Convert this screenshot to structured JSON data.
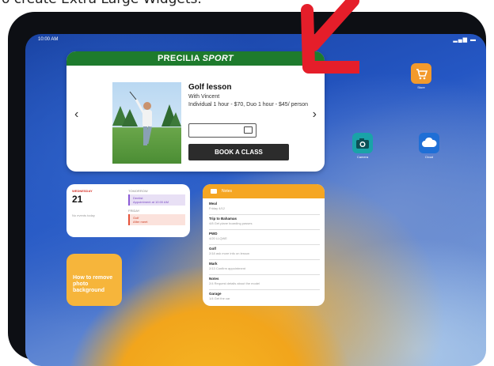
{
  "caption": "o create Extra Large Widgets.",
  "status_bar": {
    "time": "10:00 AM",
    "icons": "wifi battery"
  },
  "class_widget": {
    "brand": "PRECILIA",
    "brand_suffix": "SPORT",
    "title": "Golf lesson",
    "with": "With Vincent",
    "price": "Individual 1 hour - $70, Duo 1 hour - $45/ person",
    "book_label": "BOOK A CLASS",
    "colors": {
      "header": "#1e7b2d",
      "button": "#2c2c2c"
    }
  },
  "apps": [
    {
      "name": "Store",
      "icon": "cart-icon",
      "color": "#f39a2c"
    },
    {
      "name": "Camera",
      "icon": "camera-icon",
      "color": "#1aa3a8"
    },
    {
      "name": "Cloud",
      "icon": "cloud-icon",
      "color": "#1f6fd6"
    }
  ],
  "calendar_widget": {
    "day": "WEDNESDAY",
    "date": "21",
    "no_events": "No events today",
    "tomorrow_label": "TOMORROW",
    "tomorrow_event": {
      "title": "Dentist",
      "detail": "Appointment at 10:00 AM"
    },
    "friday_label": "FRIDAY",
    "friday_event": {
      "title": "Golf",
      "detail": "After meet"
    }
  },
  "notes_widget": {
    "header": "Notes",
    "notes": [
      {
        "title": "Meal",
        "subtitle": "Friday 4/12"
      },
      {
        "title": "Trip to Bahamas",
        "subtitle": "4/8 Get plane boarding passes"
      },
      {
        "title": "PWD",
        "subtitle": "4/20 LLQWE"
      },
      {
        "title": "Golf",
        "subtitle": "2/18 ask more info on lesson"
      },
      {
        "title": "Mark",
        "subtitle": "2/13 Confirm appointment"
      },
      {
        "title": "Notes",
        "subtitle": "2/4 Request details about the model"
      },
      {
        "title": "Garage",
        "subtitle": "1/4 Get the car"
      }
    ]
  },
  "tips_widget": {
    "text": "How to remove photo background"
  },
  "accent": "#e51e2a"
}
